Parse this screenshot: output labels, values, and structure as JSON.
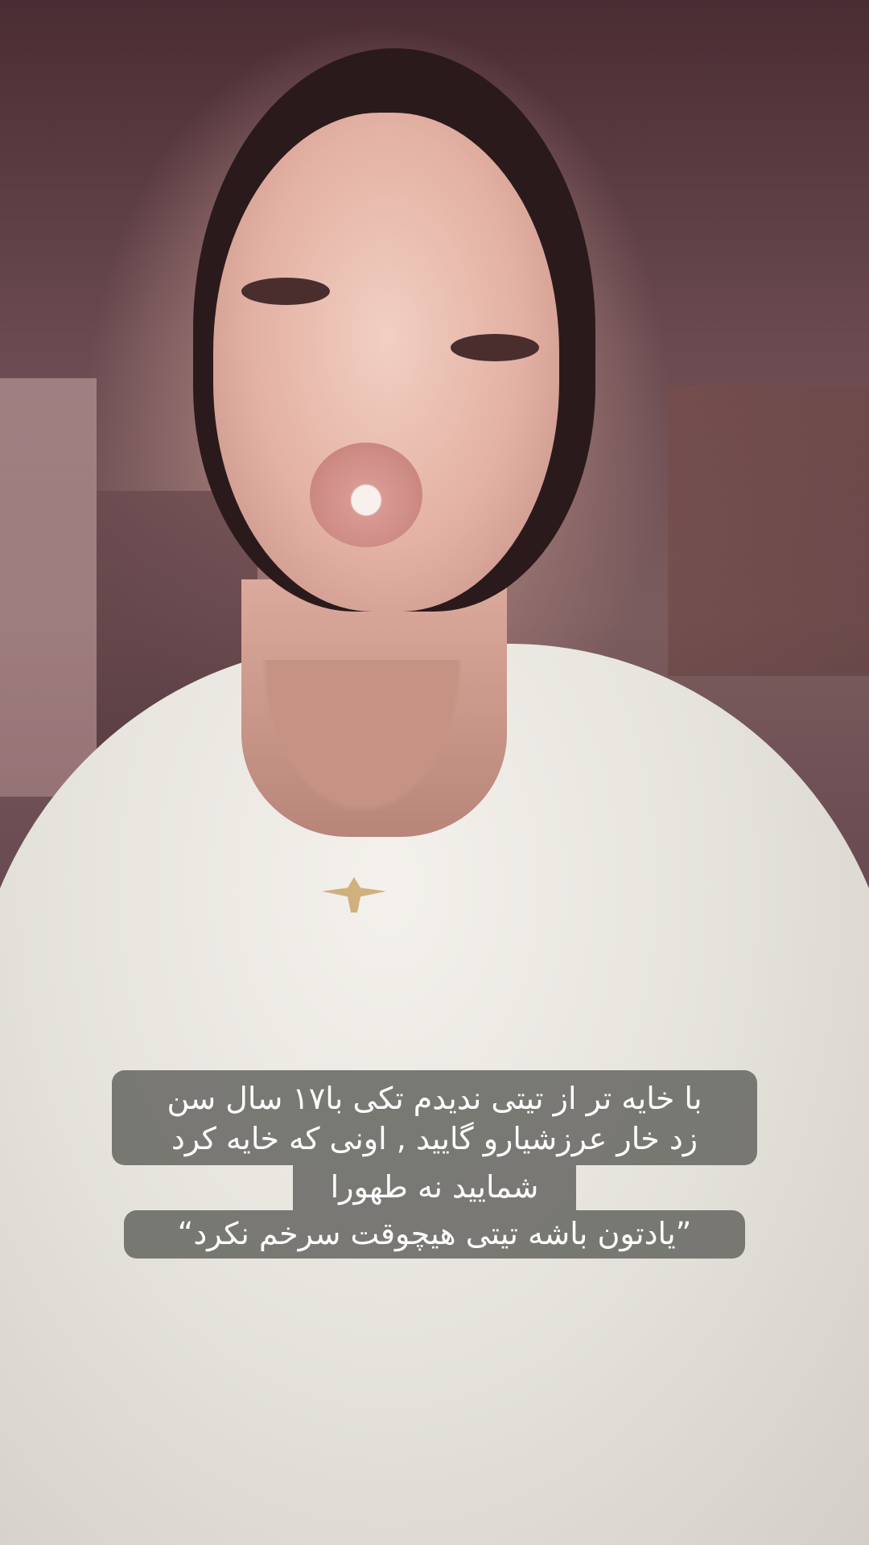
{
  "caption": {
    "lines": [
      "با خایه تر از تیتی ندیدم تکی با۱۷ سال سن",
      "زد خار عرزشیارو گایید , اونی که خایه کرد",
      "شمایید نه طهورا",
      "”یادتون باشه تیتی هیچوقت سرخم نکرد“"
    ],
    "background_color": "#696964",
    "text_color": "#ffffff"
  }
}
